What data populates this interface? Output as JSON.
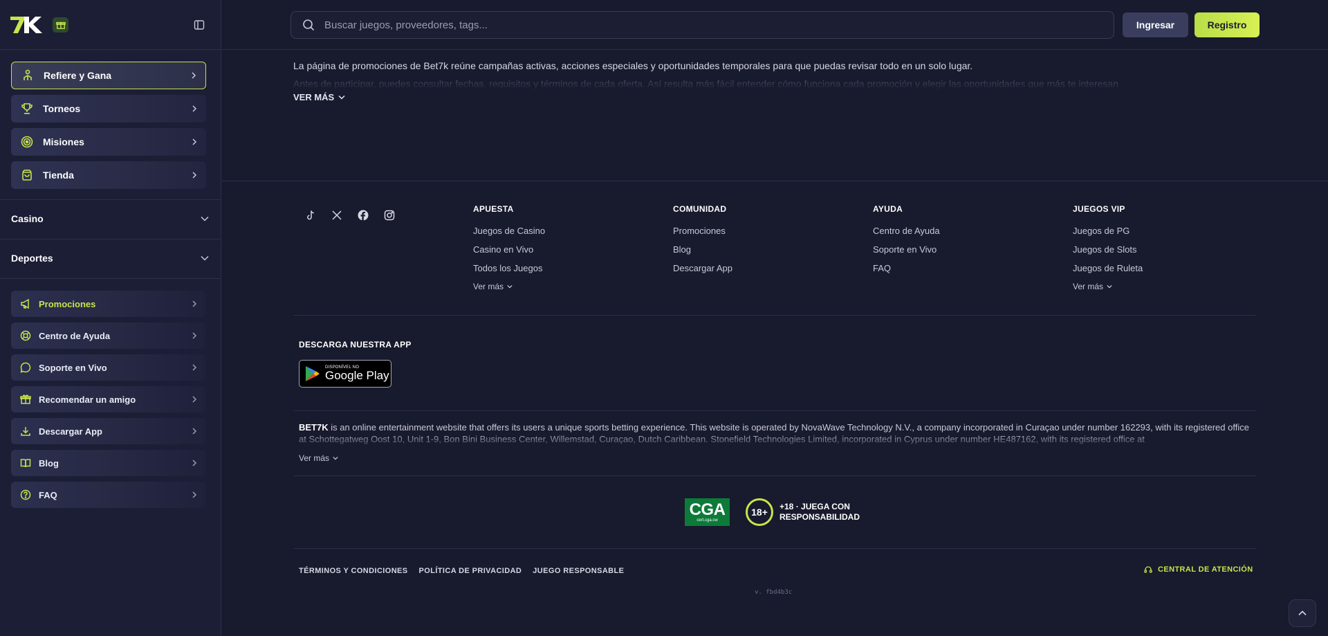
{
  "brand": {
    "logo_text": "7K",
    "accent": "#c8e44a"
  },
  "sidebar": {
    "featured": [
      {
        "label": "Refiere y Gana",
        "icon": "referral-icon",
        "active": true
      },
      {
        "label": "Torneos",
        "icon": "trophy-icon"
      },
      {
        "label": "Misiones",
        "icon": "target-icon"
      },
      {
        "label": "Tienda",
        "icon": "shopping-bag-icon"
      }
    ],
    "sections": [
      {
        "label": "Casino"
      },
      {
        "label": "Deportes"
      }
    ],
    "menu": [
      {
        "label": "Promociones",
        "icon": "megaphone-icon",
        "active": true
      },
      {
        "label": "Centro de Ayuda",
        "icon": "lifebuoy-icon"
      },
      {
        "label": "Soporte en Vivo",
        "icon": "chat-bubble-icon"
      },
      {
        "label": "Recomendar un amigo",
        "icon": "gift-icon"
      },
      {
        "label": "Descargar App",
        "icon": "download-icon"
      },
      {
        "label": "Blog",
        "icon": "book-icon"
      },
      {
        "label": "FAQ",
        "icon": "question-circle-icon"
      }
    ]
  },
  "header": {
    "search_placeholder": "Buscar juegos, proveedores, tags...",
    "login_label": "Ingresar",
    "register_label": "Registro"
  },
  "intro": {
    "line1": "La página de promociones de Bet7k reúne campañas activas, acciones especiales y oportunidades temporales para que puedas revisar todo en un solo lugar.",
    "line2": "Antes de participar, puedes consultar fechas, requisitos y términos de cada oferta. Así resulta más fácil entender cómo funciona cada promoción y elegir las oportunidades que más te interesan",
    "ver_mas": "VER MÁS"
  },
  "footer": {
    "social": [
      "tiktok-icon",
      "x-icon",
      "facebook-icon",
      "instagram-icon"
    ],
    "columns": [
      {
        "title": "APUESTA",
        "links": [
          "Juegos de Casino",
          "Casino en Vivo",
          "Todos los Juegos"
        ],
        "more": "Ver más"
      },
      {
        "title": "COMUNIDAD",
        "links": [
          "Promociones",
          "Blog",
          "Descargar App"
        ]
      },
      {
        "title": "AYUDA",
        "links": [
          "Centro de Ayuda",
          "Soporte en Vivo",
          "FAQ"
        ]
      },
      {
        "title": "JUEGOS VIP",
        "links": [
          "Juegos de PG",
          "Juegos de Slots",
          "Juegos de Ruleta"
        ],
        "more": "Ver más"
      }
    ],
    "download_title": "DESCARGA NUESTRA APP",
    "gplay_small": "DISPONÍVEL NO",
    "gplay_big": "Google Play",
    "legal_brand": "BET7K",
    "legal_text": " is an online entertainment website that offers its users a unique sports betting experience. This website is operated by NovaWave Technology N.V., a company incorporated in Curaçao under number 162293, with its registered office at Schottegatweg Oost 10, Unit 1-9, Bon Bini Business Center, Willemstad, Curaçao, Dutch Caribbean. Stonefield Technologies Limited, incorporated in Cyprus under number HE487162, with its registered office at",
    "legal_more": "Ver más",
    "cga_big": "CGA",
    "cga_small": "cert.cga.cw",
    "age_badge": "18+",
    "age_text": "+18 · JUEGA CON RESPONSABILIDAD",
    "bottom_links": [
      "TÉRMINOS Y CONDICIONES",
      "POLÍTICA DE PRIVACIDAD",
      "JUEGO RESPONSABLE"
    ],
    "central": "CENTRAL DE ATENCIÓN",
    "version": "v. fbd4b3c"
  }
}
